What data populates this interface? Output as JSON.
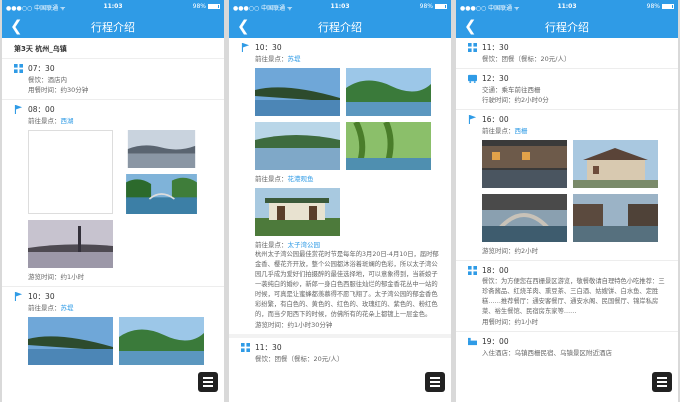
{
  "status": {
    "carrier": "●●●○○ 中国联通 ᯤ",
    "time": "11:03",
    "battery": "98%"
  },
  "nav": {
    "back": "❮",
    "title": "行程介绍"
  },
  "p1": {
    "day_title": "第3天 杭州_乌镇",
    "i1": {
      "time": "07：30",
      "l1": "餐饮：酒店内",
      "l2": "用餐时间：约30分钟"
    },
    "i2": {
      "time": "08：00",
      "go_prefix": "前往景点：",
      "go_link": "西湖",
      "visit": "游览时间：约1小时"
    },
    "i3": {
      "time": "10：30",
      "go_prefix": "前往景点：",
      "go_link": "苏堤"
    }
  },
  "p2": {
    "i1": {
      "time": "10：30",
      "go_prefix": "前往景点：",
      "go_link": "苏堤"
    },
    "i2": {
      "go_prefix": "前往景点：",
      "go_link": "花港观鱼"
    },
    "i3": {
      "go_prefix": "前往景点：",
      "go_link": "太子湾公园",
      "desc": "杭州太子湾公园最佳赏花时节是每年的3月20日-4月10日，届时郁金香、樱花齐开放，整个公园都沐浴着斑斓的色彩，所以太子湾公园几乎成为爱好们拍摄醉的最佳选择地，可以意象得到，当新娘子一袭纯白的婚纱，新郎一身白色西服往灿烂的郁金香花丛中一站的时候，可真是让蜜蜂都羡慕得不愿飞翔了。太子湾公园的郁金香色彩纷繁，有白色的、黄色的、红色的、玫瑰红的、紫色的、粉红色的，而当夕阳西下的时候，仿佛所有的花朵上都镀上一层金色。",
      "visit": "游览时间：约1小时30分钟"
    },
    "i4": {
      "time": "11：30",
      "l1": "餐饮：团餐（餐标：20元/人）"
    }
  },
  "p3": {
    "i0": {
      "time": "11：30",
      "l1": "餐饮：团餐（餐标：20元/人）"
    },
    "i1": {
      "time": "12：30",
      "l1": "交通：乘车前往西栅",
      "l2": "行驶时间：约2小时0分"
    },
    "i2": {
      "time": "16：00",
      "go_prefix": "前往景点：",
      "go_link": "西栅",
      "visit": "游览时间：约2小时"
    },
    "i3": {
      "time": "18：00",
      "desc": "餐饮：为方便您在西栅景区游览，敬餐敬请自理特色小吃推荐：三珍斋酱品、红烧羊肉、熏豆茶、三白酒、姑嫂饼、白水鱼、定胜糕……推荐餐厅：通安客餐厅、通安水阁、民国餐厅、锦岸私房菜、裕生餐馆、民宿房东家等……",
      "l2": "用餐时间：约1小时"
    },
    "i4": {
      "time": "19：00",
      "l1": "入住酒店：乌镇西栅民宿、乌镇景区附近酒店"
    }
  },
  "colors": {
    "accent": "#2f9be6"
  }
}
